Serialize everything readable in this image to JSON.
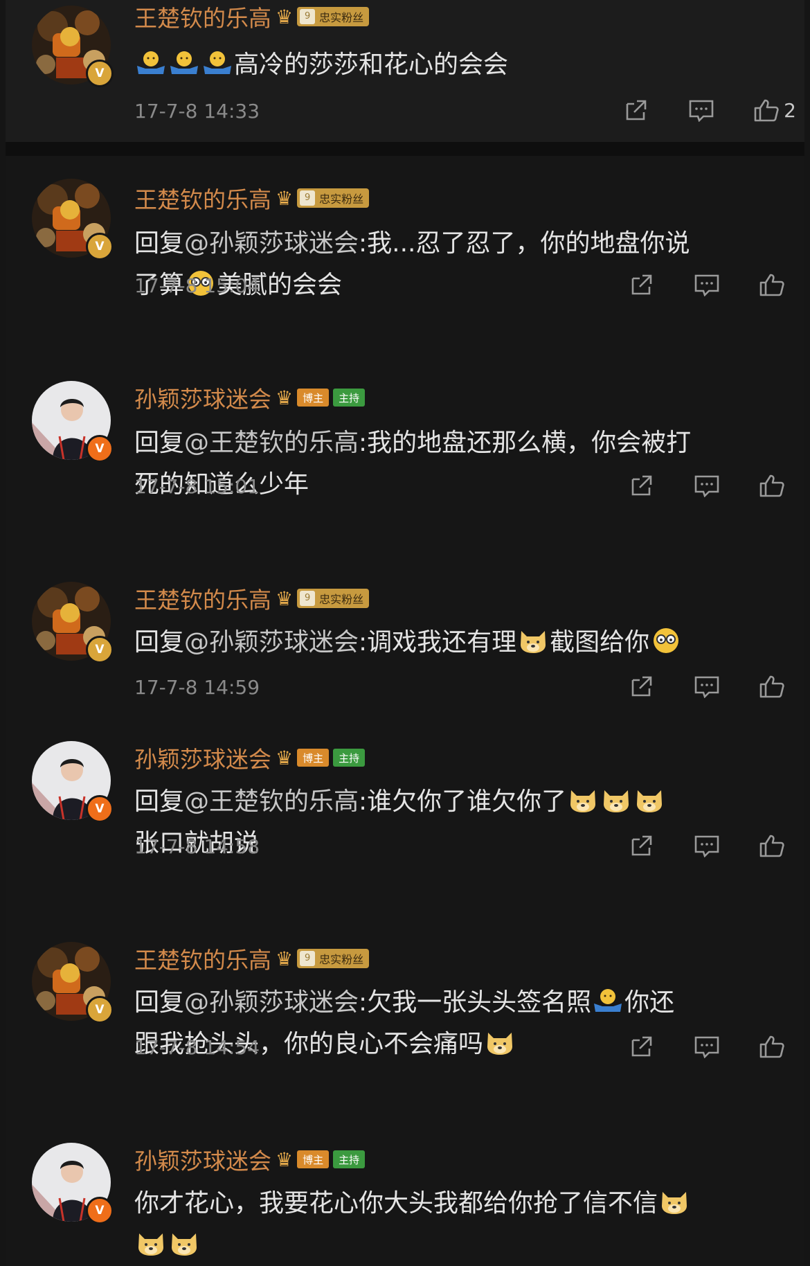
{
  "comments": [
    {
      "user": "王楚钦的乐高",
      "level": "9",
      "badge": "忠实粉丝",
      "prefix": "",
      "mention": "",
      "text": "高冷的莎莎和花心的会会",
      "text2": "",
      "time": "17-7-8 14:33",
      "likes": "2"
    },
    {
      "user": "王楚钦的乐高",
      "level": "9",
      "badge": "忠实粉丝",
      "prefix": "回复",
      "mention": "@孙颖莎球迷会",
      "text": ":我...忍了忍了，你的地盘你说",
      "text2": "了算",
      "text3": "美腻的会会",
      "time": "17-7-8 15:04"
    },
    {
      "user": "孙颖莎球迷会",
      "tag1": "博主",
      "tag2": "主持",
      "prefix": "回复",
      "mention": "@王楚钦的乐高",
      "text": ":我的地盘还那么横，你会被打",
      "text2": "死的知道么少年",
      "time": "17-7-8 15:01"
    },
    {
      "user": "王楚钦的乐高",
      "level": "9",
      "badge": "忠实粉丝",
      "prefix": "回复",
      "mention": "@孙颖莎球迷会",
      "text": ":调戏我还有理",
      "text2": "截图给你",
      "time": "17-7-8 14:59"
    },
    {
      "user": "孙颖莎球迷会",
      "tag1": "博主",
      "tag2": "主持",
      "prefix": "回复",
      "mention": "@王楚钦的乐高",
      "text": ":谁欠你了谁欠你了",
      "text2": "张口就胡说",
      "time": "17-7-8 14:58"
    },
    {
      "user": "王楚钦的乐高",
      "level": "9",
      "badge": "忠实粉丝",
      "prefix": "回复",
      "mention": "@孙颖莎球迷会",
      "text": ":欠我一张头头签名照",
      "text2": "你还",
      "text3": "跟我抢头头，你的良心不会痛吗",
      "time": "17-7-8 14:54"
    },
    {
      "user": "孙颖莎球迷会",
      "tag1": "博主",
      "tag2": "主持",
      "text": "你才花心，我要花心你大头我都给你抢了信不信"
    }
  ]
}
